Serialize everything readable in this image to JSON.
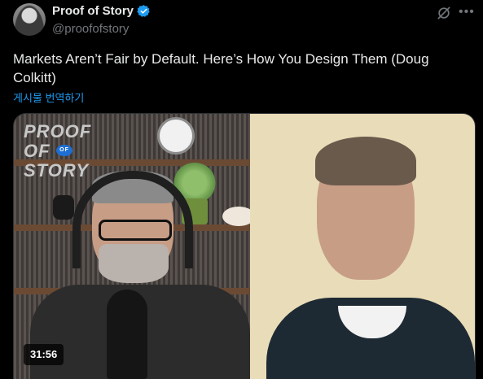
{
  "author": {
    "display_name": "Proof of Story",
    "handle": "@proofofstory",
    "verified": true,
    "verified_color": "#1d9bf0"
  },
  "tweet": {
    "text": "Markets Aren’t Fair by Default. Here’s How You Design Them (Doug Colkitt)",
    "translate_label": "게시물 번역하기"
  },
  "video": {
    "duration": "31:56",
    "logo_text": "PROOF OF STORY",
    "logo_of": "OF"
  },
  "icons": {
    "grok": "grok-icon",
    "more": "more-icon",
    "verified": "verified-badge-icon"
  }
}
